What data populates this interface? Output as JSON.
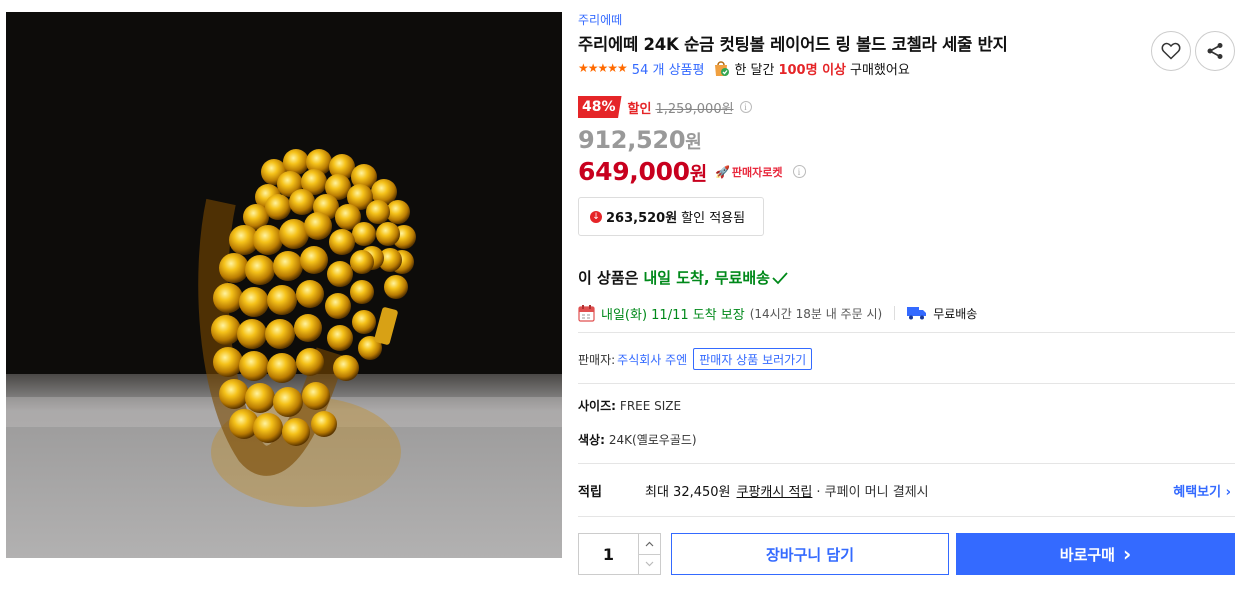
{
  "product": {
    "brand": "주리에떼",
    "title": "주리에떼 24K 순금 컷팅볼 레이어드 링 볼드 코첼라 세줄 반지",
    "image_icon": "gold-coil-ring-photo"
  },
  "rating": {
    "stars": "★★★★★",
    "review_count": "54 개 상품평",
    "sold_prefix": "한 달간",
    "sold_highlight": "100명 이상",
    "sold_suffix": "구매했어요"
  },
  "price": {
    "discount_rate": "48%",
    "discount_label": "할인",
    "original_price": "1,259,000원",
    "sale_price": "912,520",
    "final_price": "649,000",
    "currency": "원",
    "rocket_label": "판매자로켓",
    "applied_amount": "263,520원",
    "applied_text": "할인 적용됨"
  },
  "delivery": {
    "headline_prefix": "이 상품은",
    "headline_green": "내일 도착, 무료배송",
    "eta_main": "내일(화) 11/11 도착 보장",
    "eta_sub": "(14시간 18분 내 주문 시)",
    "free_shipping": "무료배송"
  },
  "seller": {
    "label": "판매자:",
    "name": "주식회사 주엔",
    "button_label": "판매자 상품 보러가기"
  },
  "options": {
    "size_label": "사이즈:",
    "size_value": "FREE SIZE",
    "color_label": "색상:",
    "color_value": "24K(옐로우골드)"
  },
  "points": {
    "label": "적립",
    "text": "최대 32,450원",
    "cash_link": "쿠팡캐시 적립",
    "extra": "· 쿠페이 머니 결제시",
    "benefit_button": "혜택보기 ›"
  },
  "purchase": {
    "quantity": "1",
    "cart_button": "장바구니 담기",
    "buy_button": "바로구매",
    "buy_arrow": "›"
  },
  "colors": {
    "accent_blue": "#346aff",
    "discount_red": "#e52528",
    "price_red": "#c8001e",
    "delivery_green": "#00891a"
  }
}
